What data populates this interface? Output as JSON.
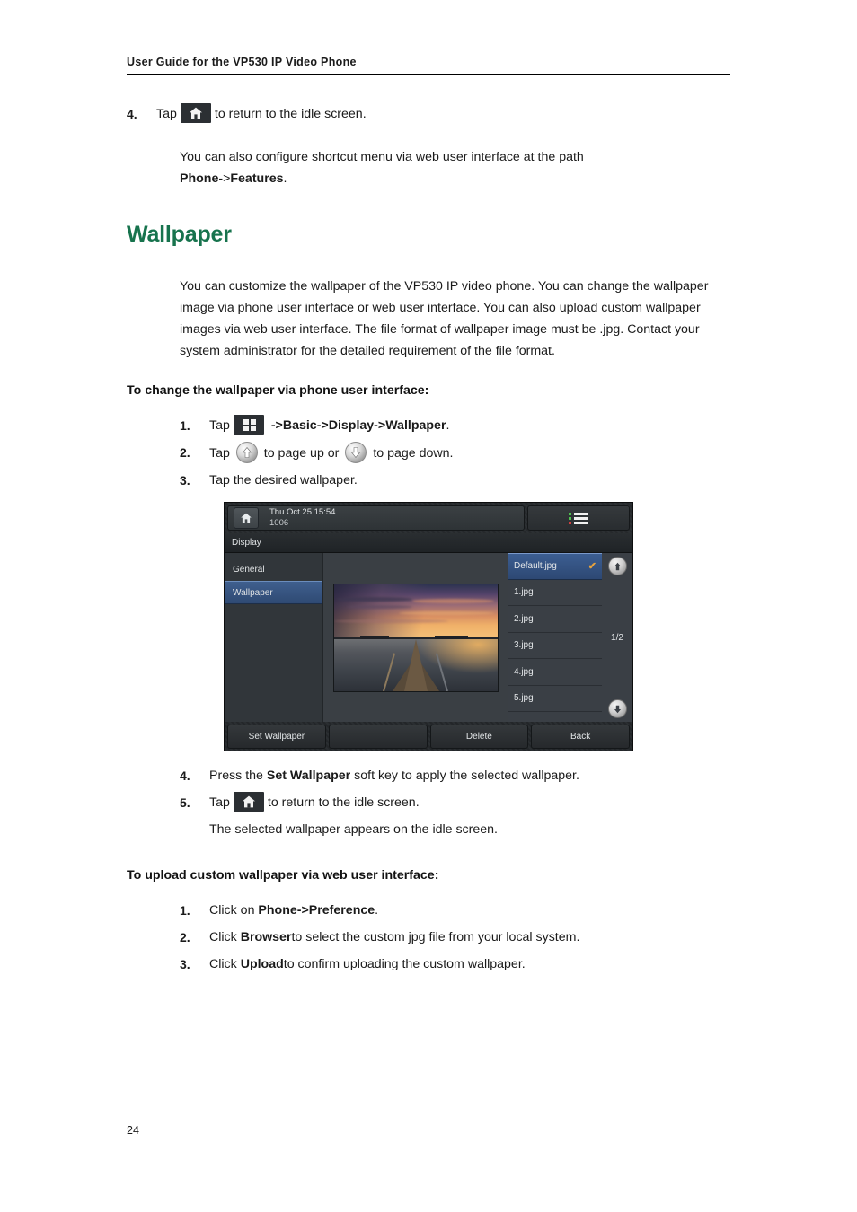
{
  "document": {
    "header": "User Guide for the VP530 IP Video Phone",
    "page_number": "24"
  },
  "intro_step": {
    "number": "4.",
    "text_before": "Tap",
    "icon": "home-icon",
    "text_after": "to return to the idle screen."
  },
  "intro_paragraph": {
    "line1": "You can also configure shortcut menu via web user interface at the path",
    "bold1": "Phone",
    "mid1": "->",
    "bold2": "Features",
    "end1": "."
  },
  "section": {
    "title": "Wallpaper",
    "body": "You can customize the wallpaper of the VP530 IP video phone. You can change the wallpaper image via phone user interface or web user interface. You can also upload custom wallpaper images via web user interface. The file format of wallpaper image must be .jpg. Contact your system administrator for the detailed requirement of the file format."
  },
  "phone_procedure": {
    "heading": "To change the wallpaper via phone user interface:",
    "steps": [
      {
        "number": "1.",
        "pre": "Tap",
        "icon": "grid-menu-icon",
        "post_plain": " ->",
        "bold_a": "Basic",
        "sep_a": "->",
        "bold_b": "Display",
        "sep_b": "->",
        "bold_c": "Wallpaper",
        "tail": "."
      },
      {
        "number": "2.",
        "pre": "Tap",
        "icon_up": "arrow-up-icon",
        "mid": "to page up or",
        "icon_down": "arrow-down-icon",
        "post": "to page down."
      },
      {
        "number": "3.",
        "text": "Tap the desired wallpaper."
      }
    ],
    "steps_after": [
      {
        "number": "4.",
        "pre": "Press the",
        "bold": "Set Wallpaper",
        "post": "soft key to apply the selected wallpaper."
      },
      {
        "number": "5.",
        "pre": "Tap",
        "icon": "home-icon",
        "post": "to return to the idle screen.",
        "note": "The selected wallpaper appears on the idle screen."
      }
    ]
  },
  "web_procedure": {
    "heading": "To upload custom wallpaper via web user interface:",
    "steps": [
      {
        "number": "1.",
        "pre": "Click on",
        "bold_a": "Phone",
        "sep": "->",
        "bold_b": "Preference",
        "tail": "."
      },
      {
        "number": "2.",
        "pre": "Click",
        "bold": "Browser",
        "post": "to select the custom jpg file from your local system."
      },
      {
        "number": "3.",
        "pre": "Click",
        "bold": "Upload",
        "post": "to confirm uploading the custom wallpaper."
      }
    ]
  },
  "phone_screenshot": {
    "status_bar": {
      "home_icon": "home-icon",
      "datetime": "Thu Oct 25 15:54",
      "account": "1006",
      "menu_icon": "list-menu-icon"
    },
    "title": "Display",
    "sidebar": [
      {
        "label": "General",
        "selected": false
      },
      {
        "label": "Wallpaper",
        "selected": true
      }
    ],
    "preview_alt": "sunset-pier-wallpaper-preview",
    "files": [
      {
        "name": "Default.jpg",
        "selected": true,
        "checked": "✔"
      },
      {
        "name": "1.jpg",
        "selected": false,
        "checked": ""
      },
      {
        "name": "2.jpg",
        "selected": false,
        "checked": ""
      },
      {
        "name": "3.jpg",
        "selected": false,
        "checked": ""
      },
      {
        "name": "4.jpg",
        "selected": false,
        "checked": ""
      },
      {
        "name": "5.jpg",
        "selected": false,
        "checked": ""
      }
    ],
    "page_indicator": "1/2",
    "scroll_up_icon": "arrow-up-icon",
    "scroll_down_icon": "arrow-down-icon",
    "soft_keys": [
      "Set Wallpaper",
      "",
      "Delete",
      "Back"
    ]
  },
  "colors": {
    "heading_green": "#17734d",
    "selection_blue": "#33527f",
    "check_orange": "#e8a33d",
    "phone_dark": "#2f3337"
  }
}
